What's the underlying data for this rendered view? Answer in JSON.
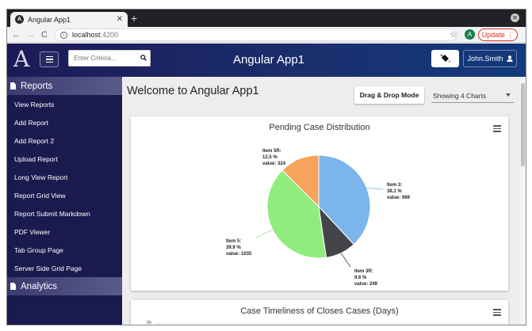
{
  "browser": {
    "tab_title": "Angular App1",
    "tab_favicon_letter": "A",
    "url_host": "localhost",
    "url_port": ":4200",
    "profile_letter": "A",
    "update_label": "Update"
  },
  "header": {
    "logo_text": "A",
    "search_placeholder": "Enter Criteria...",
    "title": "Angular App1",
    "user_name": "John.Smith"
  },
  "sidebar": {
    "sections": [
      {
        "label": "Reports"
      },
      {
        "label": "Analytics"
      }
    ],
    "items": [
      {
        "label": "View Reports"
      },
      {
        "label": "Add Report"
      },
      {
        "label": "Add Report 2"
      },
      {
        "label": "Upload Report"
      },
      {
        "label": "Long View Report"
      },
      {
        "label": "Report Grid View"
      },
      {
        "label": "Report Submit Markdown"
      },
      {
        "label": "PDF Viewer"
      },
      {
        "label": "Tab Group Page"
      },
      {
        "label": "Server Side Grid Page"
      }
    ]
  },
  "main": {
    "welcome": "Welcome to Angular App1",
    "drag_drop_label": "Drag & Drop Mode",
    "charts_select_value": "Showing 4 Charts"
  },
  "colors": {
    "sidebar_bg": "#1a1a4e",
    "header_bg": "#1c1a56",
    "slice_item3": "#7cb5ec",
    "slice_item3r": "#434348",
    "slice_item5": "#90ed7d",
    "slice_item5r": "#f7a35c"
  },
  "chart_data": [
    {
      "type": "pie",
      "title": "Pending Case Distribution",
      "slices": [
        {
          "label": "Item 3:",
          "percent_text": "38.1 %",
          "value_text": "value: 989",
          "value": 989,
          "percent": 38.1,
          "color": "#7cb5ec"
        },
        {
          "label": "Item 3R:",
          "percent_text": "9.6 %",
          "value_text": "value: 249",
          "value": 249,
          "percent": 9.6,
          "color": "#434348"
        },
        {
          "label": "Item 5:",
          "percent_text": "39.9 %",
          "value_text": "value: 1035",
          "value": 1035,
          "percent": 39.9,
          "color": "#90ed7d"
        },
        {
          "label": "Item 5R:",
          "percent_text": "12.5 %",
          "value_text": "value: 324",
          "value": 324,
          "percent": 12.5,
          "color": "#f7a35c"
        }
      ]
    },
    {
      "type": "line",
      "title": "Case Timeliness of Closes Cases (Days)",
      "y_ticks": [
        "8k"
      ]
    }
  ]
}
